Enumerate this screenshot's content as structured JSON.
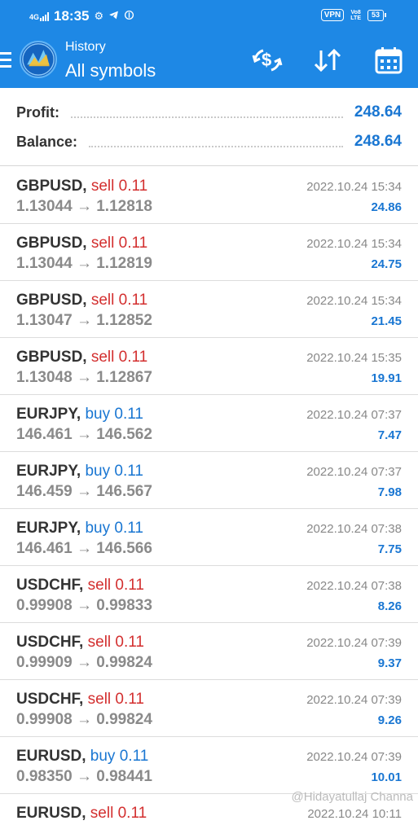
{
  "statusbar": {
    "time": "18:35",
    "network": "4G",
    "vpn": "VPN",
    "volte": "Vo8\nLTE",
    "battery": "53",
    "icons": [
      "gear-icon",
      "telegram-icon",
      "circle-d-icon"
    ]
  },
  "header": {
    "title": "History",
    "subtitle": "All symbols",
    "buttons": [
      "currency-exchange-icon",
      "sort-icon",
      "calendar-icon"
    ],
    "accent": "#1e88e5"
  },
  "summary": {
    "profit_label": "Profit:",
    "profit_value": "248.64",
    "balance_label": "Balance:",
    "balance_value": "248.64"
  },
  "deals": [
    {
      "symbol": "GBPUSD,",
      "side": "sell",
      "volume": "0.11",
      "prices": "1.13044 → 1.12818",
      "time": "2022.10.24 15:34",
      "profit": "24.86"
    },
    {
      "symbol": "GBPUSD,",
      "side": "sell",
      "volume": "0.11",
      "prices": "1.13044 → 1.12819",
      "time": "2022.10.24 15:34",
      "profit": "24.75"
    },
    {
      "symbol": "GBPUSD,",
      "side": "sell",
      "volume": "0.11",
      "prices": "1.13047 → 1.12852",
      "time": "2022.10.24 15:34",
      "profit": "21.45"
    },
    {
      "symbol": "GBPUSD,",
      "side": "sell",
      "volume": "0.11",
      "prices": "1.13048 → 1.12867",
      "time": "2022.10.24 15:35",
      "profit": "19.91"
    },
    {
      "symbol": "EURJPY,",
      "side": "buy",
      "volume": "0.11",
      "prices": "146.461 → 146.562",
      "time": "2022.10.24 07:37",
      "profit": "7.47"
    },
    {
      "symbol": "EURJPY,",
      "side": "buy",
      "volume": "0.11",
      "prices": "146.459 → 146.567",
      "time": "2022.10.24 07:37",
      "profit": "7.98"
    },
    {
      "symbol": "EURJPY,",
      "side": "buy",
      "volume": "0.11",
      "prices": "146.461 → 146.566",
      "time": "2022.10.24 07:38",
      "profit": "7.75"
    },
    {
      "symbol": "USDCHF,",
      "side": "sell",
      "volume": "0.11",
      "prices": "0.99908 → 0.99833",
      "time": "2022.10.24 07:38",
      "profit": "8.26"
    },
    {
      "symbol": "USDCHF,",
      "side": "sell",
      "volume": "0.11",
      "prices": "0.99909 → 0.99824",
      "time": "2022.10.24 07:39",
      "profit": "9.37"
    },
    {
      "symbol": "USDCHF,",
      "side": "sell",
      "volume": "0.11",
      "prices": "0.99908 → 0.99824",
      "time": "2022.10.24 07:39",
      "profit": "9.26"
    },
    {
      "symbol": "EURUSD,",
      "side": "buy",
      "volume": "0.11",
      "prices": "0.98350 → 0.98441",
      "time": "2022.10.24 07:39",
      "profit": "10.01"
    },
    {
      "symbol": "EURUSD,",
      "side": "sell",
      "volume": "0.11",
      "prices": "",
      "time": "2022.10.24 10:11",
      "profit": ""
    }
  ],
  "colors": {
    "sell": "#d32f2f",
    "buy": "#1976d2",
    "profit": "#1976d2",
    "price": "#8a8a8a"
  },
  "watermark": "@Hidayatullaj Channa"
}
